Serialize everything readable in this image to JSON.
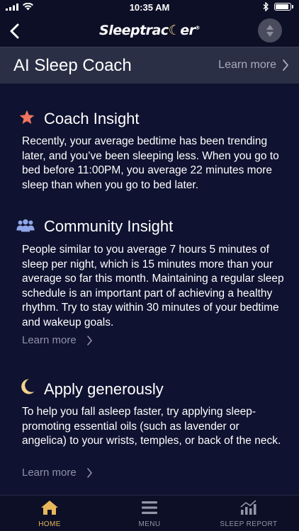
{
  "status_bar": {
    "time": "10:35 AM"
  },
  "nav": {
    "logo_text": "Sleeptrac",
    "logo_moon": "☾",
    "logo_tail": "er",
    "logo_mark": "®"
  },
  "section": {
    "title": "AI Sleep Coach",
    "learn_more": "Learn more"
  },
  "cards": [
    {
      "icon": "star-icon",
      "title": "Coach Insight",
      "body": "Recently, your average bedtime has been trending later, and you’ve been sleeping less. When you go to bed before 11:00PM, you average 22 minutes more sleep than when you go to bed later."
    },
    {
      "icon": "people-icon",
      "title": "Community Insight",
      "body": "People similar to you average 7 hours 5 minutes of sleep per night, which is 15 minutes more than your average so far this month. Maintaining a regular sleep schedule is an important part of achieving a healthy rhythm. Try to stay within 30 minutes of your bedtime and wakeup goals.",
      "link": "Learn more"
    },
    {
      "icon": "moon-icon",
      "title": "Apply generously",
      "body": "To help you fall asleep faster, try applying sleep-promoting essential oils (such as lavender or angelica) to your wrists, temples, or back of the neck.",
      "link": "Learn more"
    }
  ],
  "tabs": [
    {
      "label": "HOME",
      "icon": "home-icon",
      "active": true
    },
    {
      "label": "MENU",
      "icon": "menu-icon",
      "active": false
    },
    {
      "label": "SLEEP REPORT",
      "icon": "bar-chart-icon",
      "active": false
    }
  ],
  "colors": {
    "background": "#0f1230",
    "header_band": "#2b2f45",
    "accent_gold": "#e8b75a",
    "star_coral": "#ef7560",
    "people_blue": "#8fa6e8",
    "moon_cream": "#f2d28a"
  }
}
